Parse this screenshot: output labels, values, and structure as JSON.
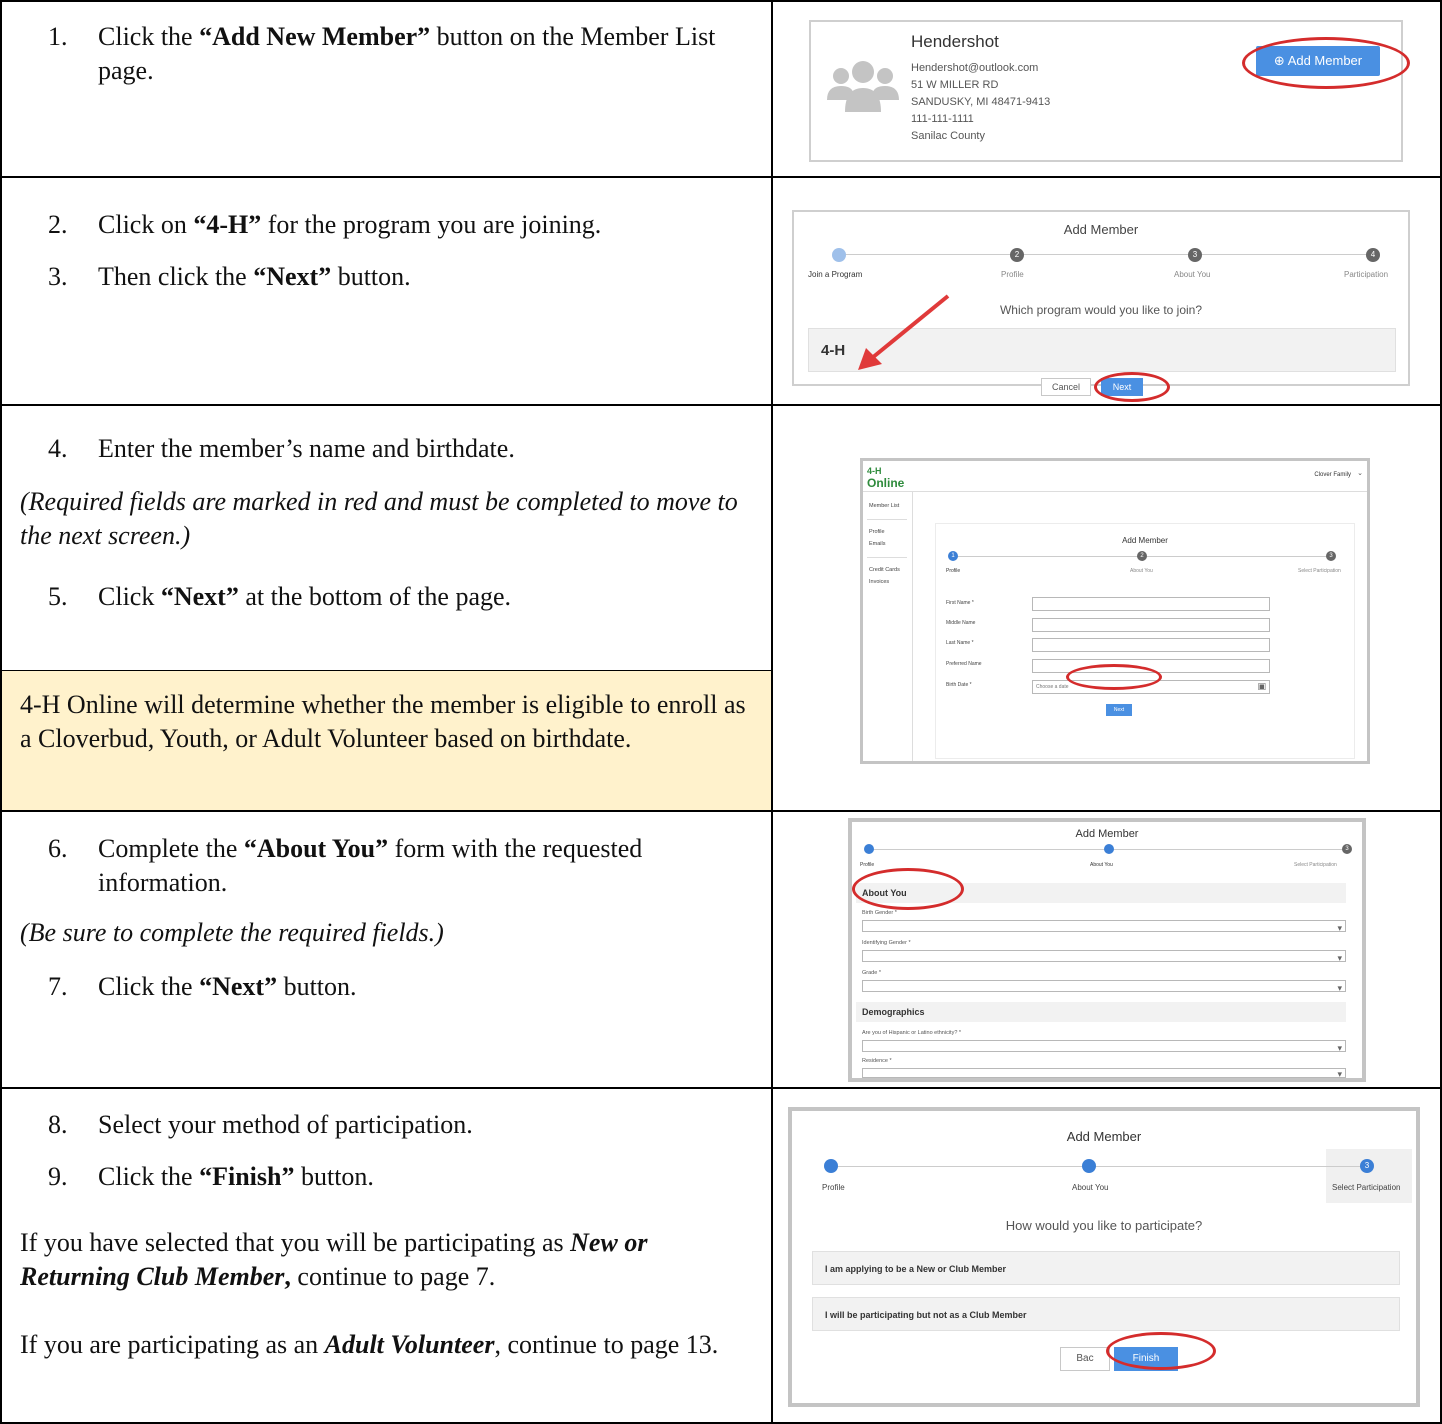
{
  "rows": [
    {
      "steps": [
        {
          "num": "1.",
          "pre": "Click the ",
          "bold": "“Add New Member”",
          "post": " button on the Member List page."
        }
      ]
    },
    {
      "steps": [
        {
          "num": "2.",
          "pre": "Click on ",
          "bold": "“4-H”",
          "post": " for the program you are joining."
        },
        {
          "num": "3.",
          "pre": "Then click the ",
          "bold": "“Next”",
          "post": " button."
        }
      ]
    },
    {
      "steps": [
        {
          "num": "4.",
          "text": "Enter the member’s name and birthdate."
        },
        {
          "num": "5.",
          "pre": "Click ",
          "bold": "“Next”",
          "post": " at the bottom of the page."
        }
      ],
      "note": "(Required fields are marked in red and must be completed to move to the next screen.)",
      "callout": "4-H Online will determine whether the member is eligible to enroll as a Cloverbud, Youth, or Adult Volunteer based on birthdate."
    },
    {
      "steps": [
        {
          "num": "6.",
          "pre": "Complete the ",
          "bold": "“About You”",
          "post": " form with the requested information."
        },
        {
          "num": "7.",
          "pre": "Click the ",
          "bold": "“Next”",
          "post": " button."
        }
      ],
      "note": "(Be sure to complete the required fields.)"
    },
    {
      "steps": [
        {
          "num": "8.",
          "text": "Select your method of participation."
        },
        {
          "num": "9.",
          "pre": "Click the ",
          "bold": "“Finish”",
          "post": " button."
        }
      ],
      "para1": {
        "pre": "If you have selected that you will be participating as ",
        "bi": "New or Returning Club Member",
        "bold": ",",
        "post": " continue to page 7."
      },
      "para2": {
        "pre": "If you are participating as an ",
        "bi": "Adult Volunteer",
        "post": ", continue to page 13."
      }
    }
  ],
  "shot1": {
    "name": "Hendershot",
    "email": "Hendershot@outlook.com",
    "address1": "51 W MILLER RD",
    "address2": "SANDUSKY, MI 48471-9413",
    "phone": "111-111-1111",
    "county": "Sanilac County",
    "button": "Add Member"
  },
  "shot2": {
    "title": "Add Member",
    "steps": [
      "Join a Program",
      "Profile",
      "About You",
      "Participation"
    ],
    "step_nums": [
      "2",
      "3",
      "4"
    ],
    "question": "Which program would you like to join?",
    "program": "4-H",
    "cancel": "Cancel",
    "next": "Next"
  },
  "shot3": {
    "logo_top": "4-H",
    "logo_bottom": "Online",
    "family": "Clover Family",
    "nav": [
      "Member List",
      "Profile",
      "Emails",
      "Credit Cards",
      "Invoices"
    ],
    "title": "Add Member",
    "steps": [
      "Profile",
      "About You",
      "Select Participation"
    ],
    "step_nums": [
      "1",
      "2",
      "3"
    ],
    "fields": [
      "First Name *",
      "Middle Name",
      "Last Name *",
      "Preferred Name",
      "Birth Date *"
    ],
    "date_placeholder": "Choose a date",
    "next": "Next"
  },
  "shot4": {
    "title": "Add Member",
    "steps": [
      "Profile",
      "About You",
      "Select Participation"
    ],
    "step_num": "3",
    "section1": "About You",
    "fields1": [
      "Birth Gender *",
      "Identifying Gender *",
      "Grade *"
    ],
    "section2": "Demographics",
    "fields2": [
      "Are you of Hispanic or Latino ethnicity? *",
      "Residence *"
    ]
  },
  "shot5": {
    "title": "Add Member",
    "steps": [
      "Profile",
      "About You",
      "Select Participation"
    ],
    "step_num": "3",
    "question": "How would you like to participate?",
    "options": [
      "I am applying to be a New or Club Member",
      "I will be participating but not as a Club Member"
    ],
    "back": "Bac",
    "finish": "Finish"
  },
  "colors": {
    "callout_bg": "#fff2cc",
    "accent_blue": "#4a90e2",
    "annotation_red": "#d42c2c"
  }
}
